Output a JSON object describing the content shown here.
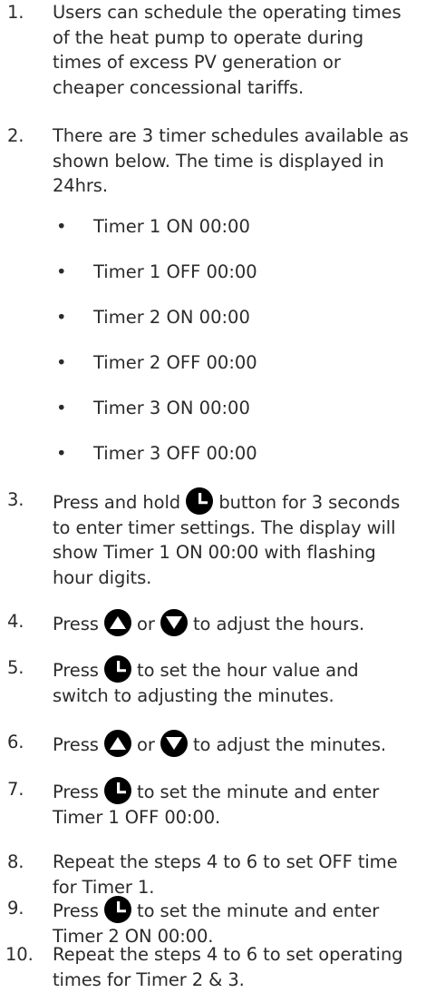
{
  "items": [
    {
      "num": "1.",
      "text": "Users can schedule the operating times of the heat pump to operate during times of excess PV generation or cheaper concessional tariffs."
    },
    {
      "num": "2.",
      "text": "There are 3 timer schedules available as shown below. The time  is displayed in 24hrs."
    },
    {
      "num": "3.",
      "a": "Press and hold",
      "b": "button for 3",
      "c": "seconds to enter timer settings. The display will show Timer 1 ON 00:00 with flashing hour digits."
    },
    {
      "num": "4.",
      "a": "Press",
      "b": "or",
      "c": "to adjust the hours."
    },
    {
      "num": "5.",
      "a": "Press",
      "b": "to set the hour value and",
      "c": "switch to adjusting the minutes."
    },
    {
      "num": "6.",
      "a": "Press",
      "b": "or",
      "c": "to adjust the minutes."
    },
    {
      "num": "7.",
      "a": "Press",
      "b": "to set the minute and enter",
      "c": "Timer 1 OFF 00:00."
    },
    {
      "num": "8.",
      "text": "Repeat the steps 4 to 6 to set OFF time for Timer 1."
    },
    {
      "num": "9.",
      "a": "Press",
      "b": "to set the minute and enter",
      "c": "Timer 2 ON 00:00."
    },
    {
      "num": "10.",
      "text": "Repeat the steps 4 to 6 to set operating times for Timer 2 & 3."
    }
  ],
  "timers": [
    "Timer 1 ON 00:00",
    "Timer 1 OFF 00:00",
    "Timer 2 ON 00:00",
    "Timer 2 OFF 00:00",
    "Timer 3 ON 00:00",
    "Timer 3 OFF 00:00"
  ],
  "bullet_char": "•",
  "icons": {
    "clock": "clock-icon",
    "up": "up-triangle-icon",
    "down": "down-triangle-icon"
  },
  "colors": {
    "text": "#2b2b2b",
    "icon": "#000000"
  }
}
